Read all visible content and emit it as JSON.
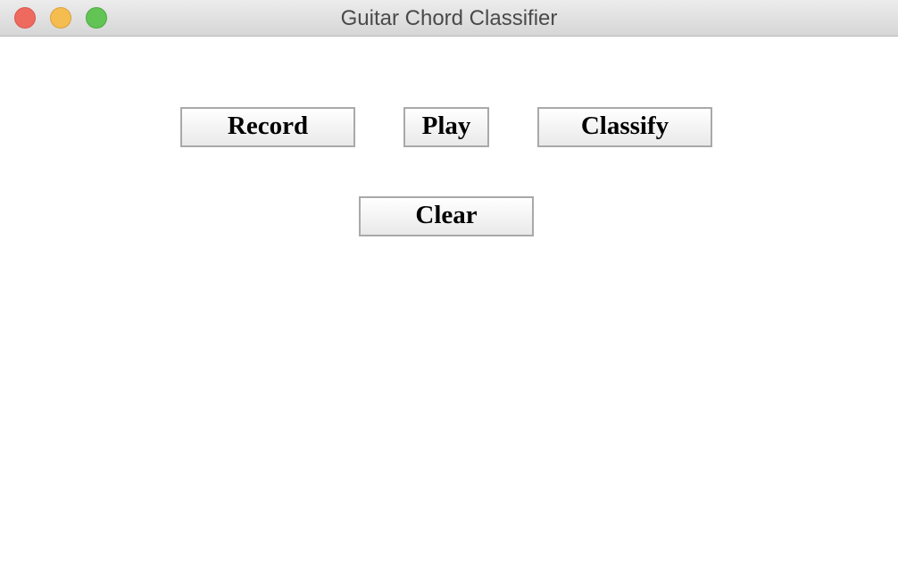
{
  "window": {
    "title": "Guitar Chord Classifier",
    "controls": [
      "close",
      "minimize",
      "zoom"
    ]
  },
  "buttons": {
    "record_label": "Record",
    "play_label": "Play",
    "classify_label": "Classify",
    "clear_label": "Clear"
  },
  "colors": {
    "close": "#ee6a5f",
    "minimize": "#f5bd4f",
    "zoom": "#61c454",
    "button_border": "#a9a9a9"
  }
}
